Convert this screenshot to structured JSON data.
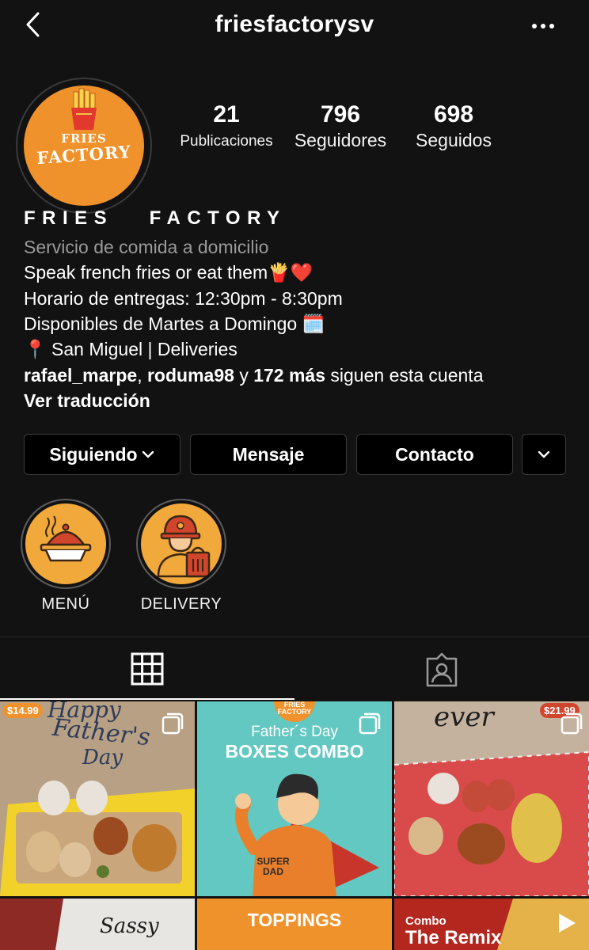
{
  "header": {
    "username": "friesfactorysv",
    "back_icon": "chevron-left-icon",
    "more_icon": "more-horizontal-icon"
  },
  "profile": {
    "avatar_text_line1": "FRIES",
    "avatar_text_line2": "FACTORY",
    "stats": [
      {
        "value": "21",
        "label": "Publicaciones"
      },
      {
        "value": "796",
        "label": "Seguidores"
      },
      {
        "value": "698",
        "label": "Seguidos"
      }
    ],
    "display_name": "FRIES   FACTORY",
    "category": "Servicio de comida a domicilio",
    "bio_lines": [
      "Speak french fries or eat them🍟❤️",
      "Horario de entregas: 12:30pm - 8:30pm",
      "Disponibles de Martes a Domingo 🗓️",
      "📍 San Miguel | Deliveries"
    ],
    "followed_by": {
      "user1": "rafael_marpe",
      "sep1": ",",
      "user2": "roduma98",
      "connector": "y",
      "count": "172 más",
      "suffix": "siguen esta cuenta"
    },
    "translate_link": "Ver traducción"
  },
  "actions": {
    "following_label": "Siguiendo",
    "message_label": "Mensaje",
    "contact_label": "Contacto"
  },
  "highlights": [
    {
      "label": "MENÚ",
      "icon": "covered-dish-icon"
    },
    {
      "label": "DELIVERY",
      "icon": "delivery-person-icon"
    }
  ],
  "tabs": [
    {
      "name": "grid",
      "icon": "grid-icon",
      "active": true
    },
    {
      "name": "tagged",
      "icon": "tagged-person-icon",
      "active": false
    }
  ],
  "posts": [
    {
      "price": "$14.99",
      "text1": "Happy",
      "text2": "Father's",
      "text3": "Day",
      "multi": true
    },
    {
      "brand1": "FRIES",
      "brand2": "FACTORY",
      "text1": "Father´s Day",
      "text2": "BOXES COMBO",
      "shirt1": "SUPER",
      "shirt2": "DAD",
      "multi": true
    },
    {
      "price": "$21.99",
      "text1": "ever",
      "multi": true
    },
    {
      "text1": "Sassy"
    },
    {
      "text1": "TOPPINGS"
    },
    {
      "text1": "Combo",
      "text2": "The Remix"
    }
  ],
  "colors": {
    "background": "#121212",
    "avatar_orange": "#f0922b",
    "highlight_yellow": "#f2a93b",
    "teal": "#63c8c1"
  }
}
